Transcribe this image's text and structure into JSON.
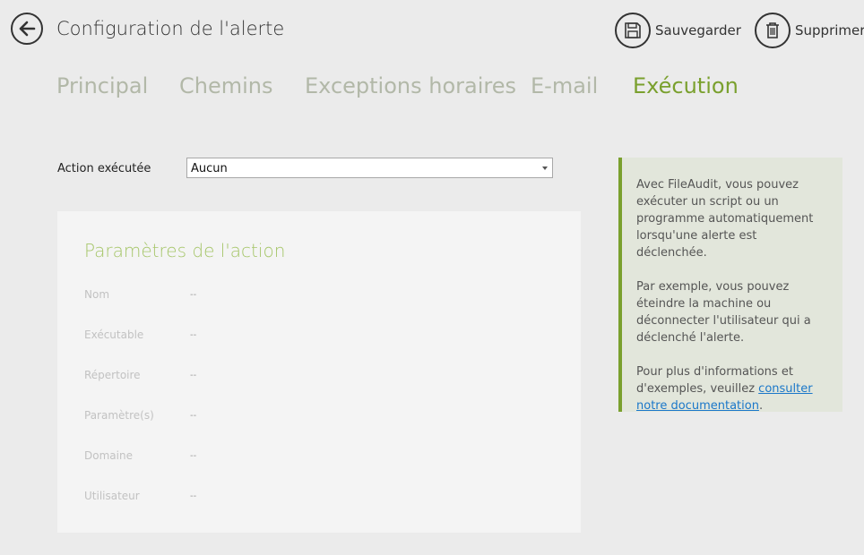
{
  "header": {
    "title": "Configuration de l'alerte",
    "save_label": "Sauvegarder",
    "delete_label": "Supprimer"
  },
  "tabs": [
    {
      "label": "Principal",
      "active": false
    },
    {
      "label": "Chemins",
      "active": false
    },
    {
      "label": "Exceptions horaires",
      "active": false
    },
    {
      "label": "E-mail",
      "active": false
    },
    {
      "label": "Exécution",
      "active": true
    }
  ],
  "action": {
    "label": "Action exécutée",
    "selected": "Aucun"
  },
  "params": {
    "title": "Paramètres de l'action",
    "rows": [
      {
        "label": "Nom",
        "value": "--"
      },
      {
        "label": "Exécutable",
        "value": "--"
      },
      {
        "label": "Répertoire",
        "value": "--"
      },
      {
        "label": "Paramètre(s)",
        "value": "--"
      },
      {
        "label": "Domaine",
        "value": "--"
      },
      {
        "label": "Utilisateur",
        "value": "--"
      }
    ]
  },
  "info": {
    "p1": "Avec FileAudit, vous pouvez exécuter un script ou un programme automatiquement lorsqu'une alerte est déclenchée.",
    "p2": "Par exemple, vous pouvez éteindre la machine ou déconnecter l'utilisateur qui a déclenché l'alerte.",
    "p3_prefix": "Pour plus d'informations et d'exemples, veuillez ",
    "p3_link": "consulter notre documentation",
    "p3_suffix": "."
  },
  "colors": {
    "accent": "#7aa02e",
    "tab_inactive": "#b2b8a8",
    "link": "#1a77c9",
    "info_bg": "#e2e6db"
  },
  "icons": {
    "back": "arrow-left-icon",
    "save": "floppy-disk-icon",
    "delete": "trash-icon",
    "dropdown": "dropdown-arrow-icon"
  }
}
